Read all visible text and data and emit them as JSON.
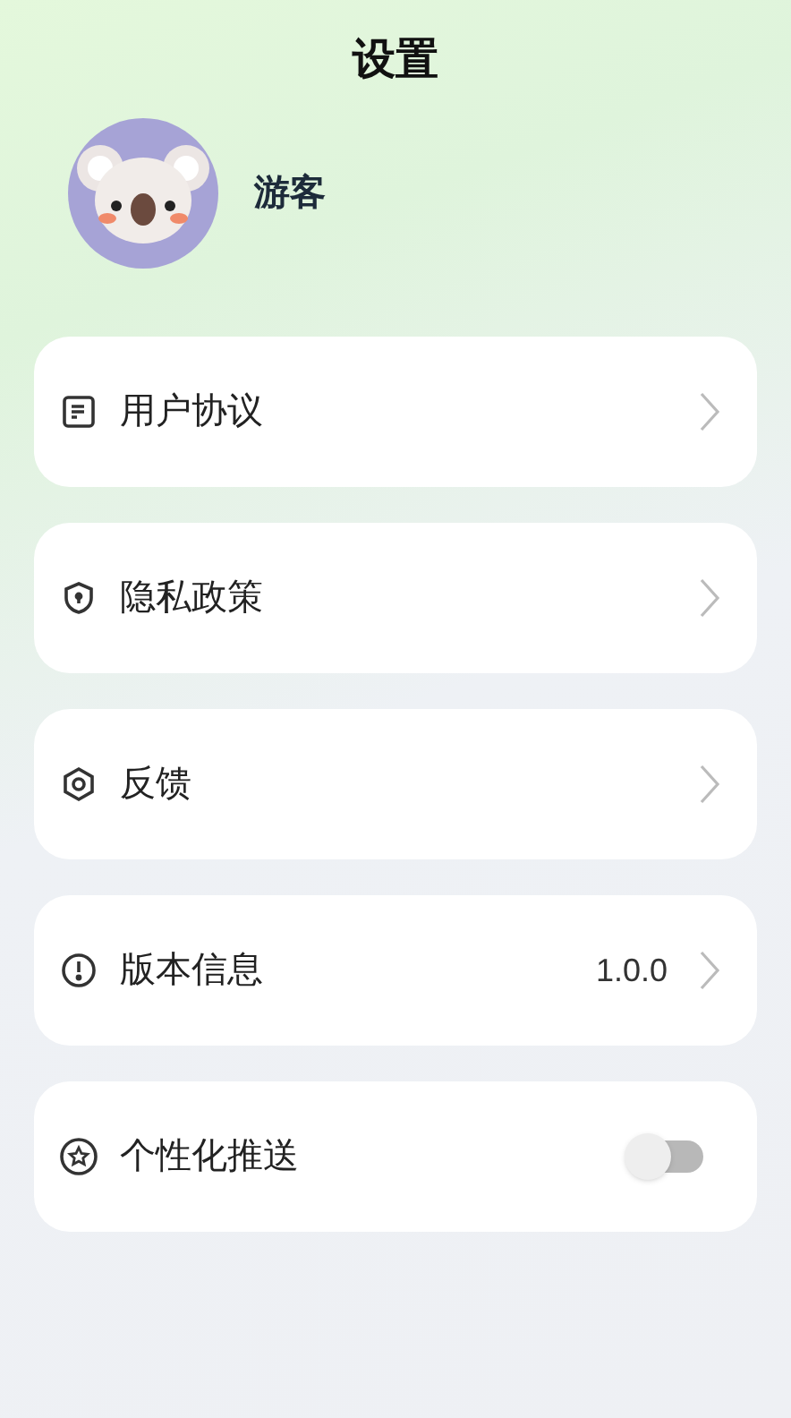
{
  "title": "设置",
  "user": {
    "name": "游客"
  },
  "items": [
    {
      "kind": "link",
      "label": "用户协议"
    },
    {
      "kind": "link",
      "label": "隐私政策"
    },
    {
      "kind": "link",
      "label": "反馈"
    },
    {
      "kind": "link",
      "label": "版本信息",
      "value": "1.0.0"
    },
    {
      "kind": "toggle",
      "label": "个性化推送",
      "on": false
    }
  ]
}
